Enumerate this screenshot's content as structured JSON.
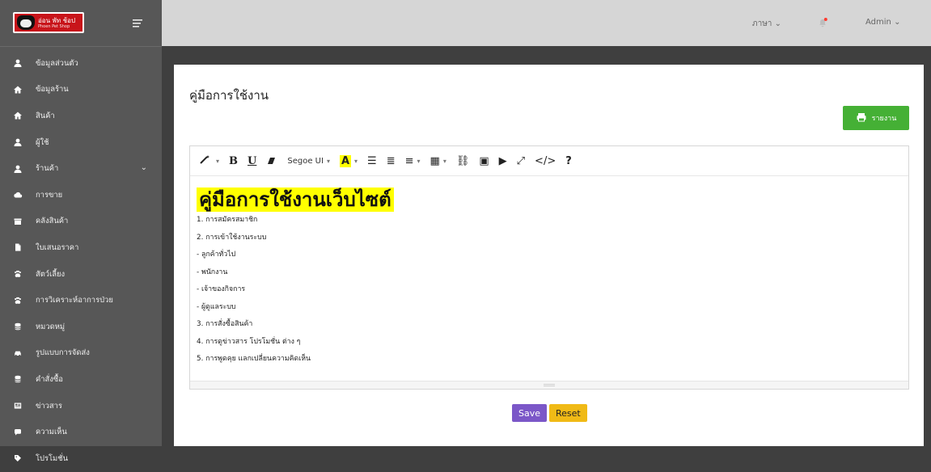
{
  "sidebar": {
    "brand": {
      "title": "อ่อน พัท ช้อป",
      "subtitle": "Phoen Pet Shop"
    },
    "items": [
      {
        "label": "ข้อมูลส่วนตัว",
        "icon": "user-icon"
      },
      {
        "label": "ข้อมูลร้าน",
        "icon": "home-icon"
      },
      {
        "label": "สินค้า",
        "icon": "home-icon"
      },
      {
        "label": "ผู้ใช้",
        "icon": "user-icon"
      },
      {
        "label": "ร้านค้า",
        "icon": "user-icon",
        "has_chevron": true
      },
      {
        "label": "การขาย",
        "icon": "cloud-icon"
      },
      {
        "label": "คลังสินค้า",
        "icon": "box-icon"
      },
      {
        "label": "ใบเสนอราคา",
        "icon": "document-icon"
      },
      {
        "label": "สัตว์เลี้ยง",
        "icon": "paw-icon"
      },
      {
        "label": "การวิเคราะห์อาการป่วย",
        "icon": "paw-icon"
      },
      {
        "label": "หมวดหมู่",
        "icon": "database-icon"
      },
      {
        "label": "รูปแบบการจัดส่ง",
        "icon": "car-icon"
      },
      {
        "label": "คำสั่งซื้อ",
        "icon": "database-icon"
      },
      {
        "label": "ข่าวสาร",
        "icon": "newspaper-icon"
      },
      {
        "label": "ความเห็น",
        "icon": "comment-icon"
      },
      {
        "label": "โปรโมชั่น",
        "icon": "tag-icon"
      }
    ]
  },
  "topbar": {
    "language": "ภาษา",
    "user": "Admin"
  },
  "main": {
    "title": "คู่มือการใช้งาน",
    "report_button": "รายงาน",
    "editor": {
      "font_name": "Segoe UI",
      "heading": "คู่มือการใช้งานเว็บไซต์",
      "lines": [
        "1. การสมัครสมาชิก",
        "2. การเข้าใช้งานระบบ",
        "   - ลูกค้าทั่วไป",
        "   - พนักงาน",
        "   - เจ้าของกิจการ",
        "   - ผู้ดูแลระบบ",
        "3. การสั่งซื้อสินค้า",
        "4. การดูข่าวสาร โปรโมชั่น ต่าง ๆ",
        "5. การพูดคุย แลกเปลี่ยนความคิดเห็น"
      ]
    },
    "actions": {
      "save": "Save",
      "reset": "Reset"
    }
  },
  "colors": {
    "sidebar_bg": "#575757",
    "topbar_bg": "#d6d6d6",
    "accent_green": "#45b035",
    "save_purple": "#7b57c8",
    "reset_yellow": "#f0ba16",
    "highlight_yellow": "#ffff00"
  }
}
